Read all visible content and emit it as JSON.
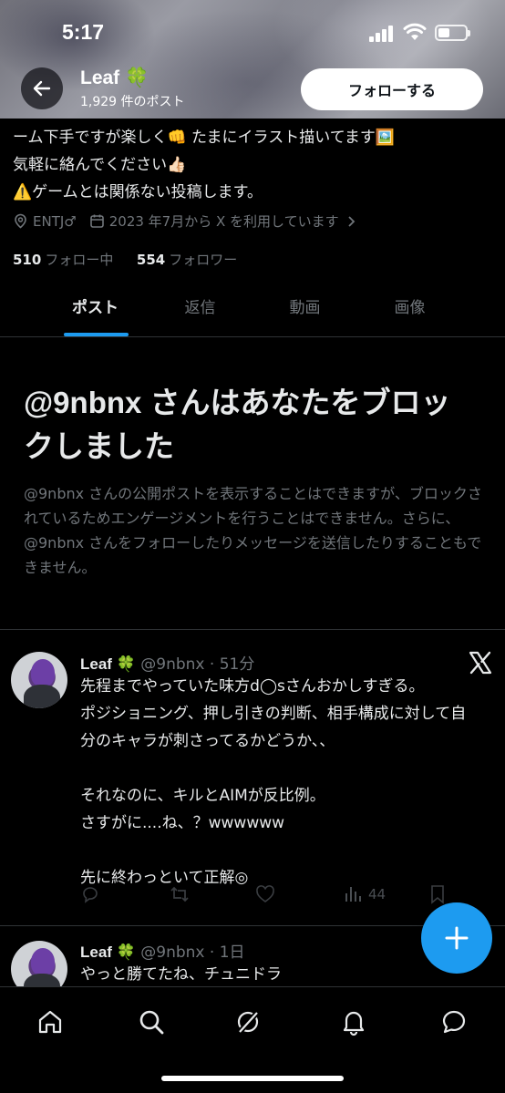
{
  "status_bar": {
    "time": "5:17"
  },
  "header": {
    "profile_name": "Leaf 🍀",
    "post_count": "1,929 件のポスト",
    "follow_label": "フォローする",
    "back_icon": "arrow-left-icon"
  },
  "bio": {
    "lines": [
      "ーム下手ですが楽しく👊 たまにイラスト描いてます🖼️",
      "気軽に絡んでください👍🏻",
      "⚠️ゲームとは関係ない投稿します。"
    ]
  },
  "meta": {
    "location": "ENTJ♂",
    "joined": "2023 年7月から X を利用しています"
  },
  "stats": {
    "following_count": "510",
    "following_label": "フォロー中",
    "followers_count": "554",
    "followers_label": "フォロワー"
  },
  "tabs": [
    {
      "label": "ポスト",
      "active": true
    },
    {
      "label": "返信",
      "active": false
    },
    {
      "label": "動画",
      "active": false
    },
    {
      "label": "画像",
      "active": false
    }
  ],
  "blocked": {
    "title": "@9nbnx さんはあなたをブロックしました",
    "description": "@9nbnx さんの公開ポストを表示することはできますが、ブロックされているためエンゲージメントを行うことはできません。さらに、@9nbnx さんをフォローしたりメッセージを送信したりすることもできません。"
  },
  "posts": [
    {
      "name": "Leaf 🍀",
      "handle_time": "@9nbnx · 51分",
      "text": "先程までやっていた味方d◯sさんおかしすぎる。\nポジショニング、押し引きの判断、相手構成に対して自分のキャラが刺さってるかどうか、、\n\nそれなのに、キルとAIMが反比例。\nさすがに....ね、？wwwwww\n\n先に終わっといて正解◎",
      "views": "44"
    },
    {
      "name": "Leaf 🍀",
      "handle_time": "@9nbnx · 1日",
      "text": "やっと勝てたね、チュニドラ"
    }
  ],
  "colors": {
    "accent": "#1d9bf0",
    "background": "#000000",
    "muted": "#71767b",
    "text": "#e7e9ea"
  }
}
